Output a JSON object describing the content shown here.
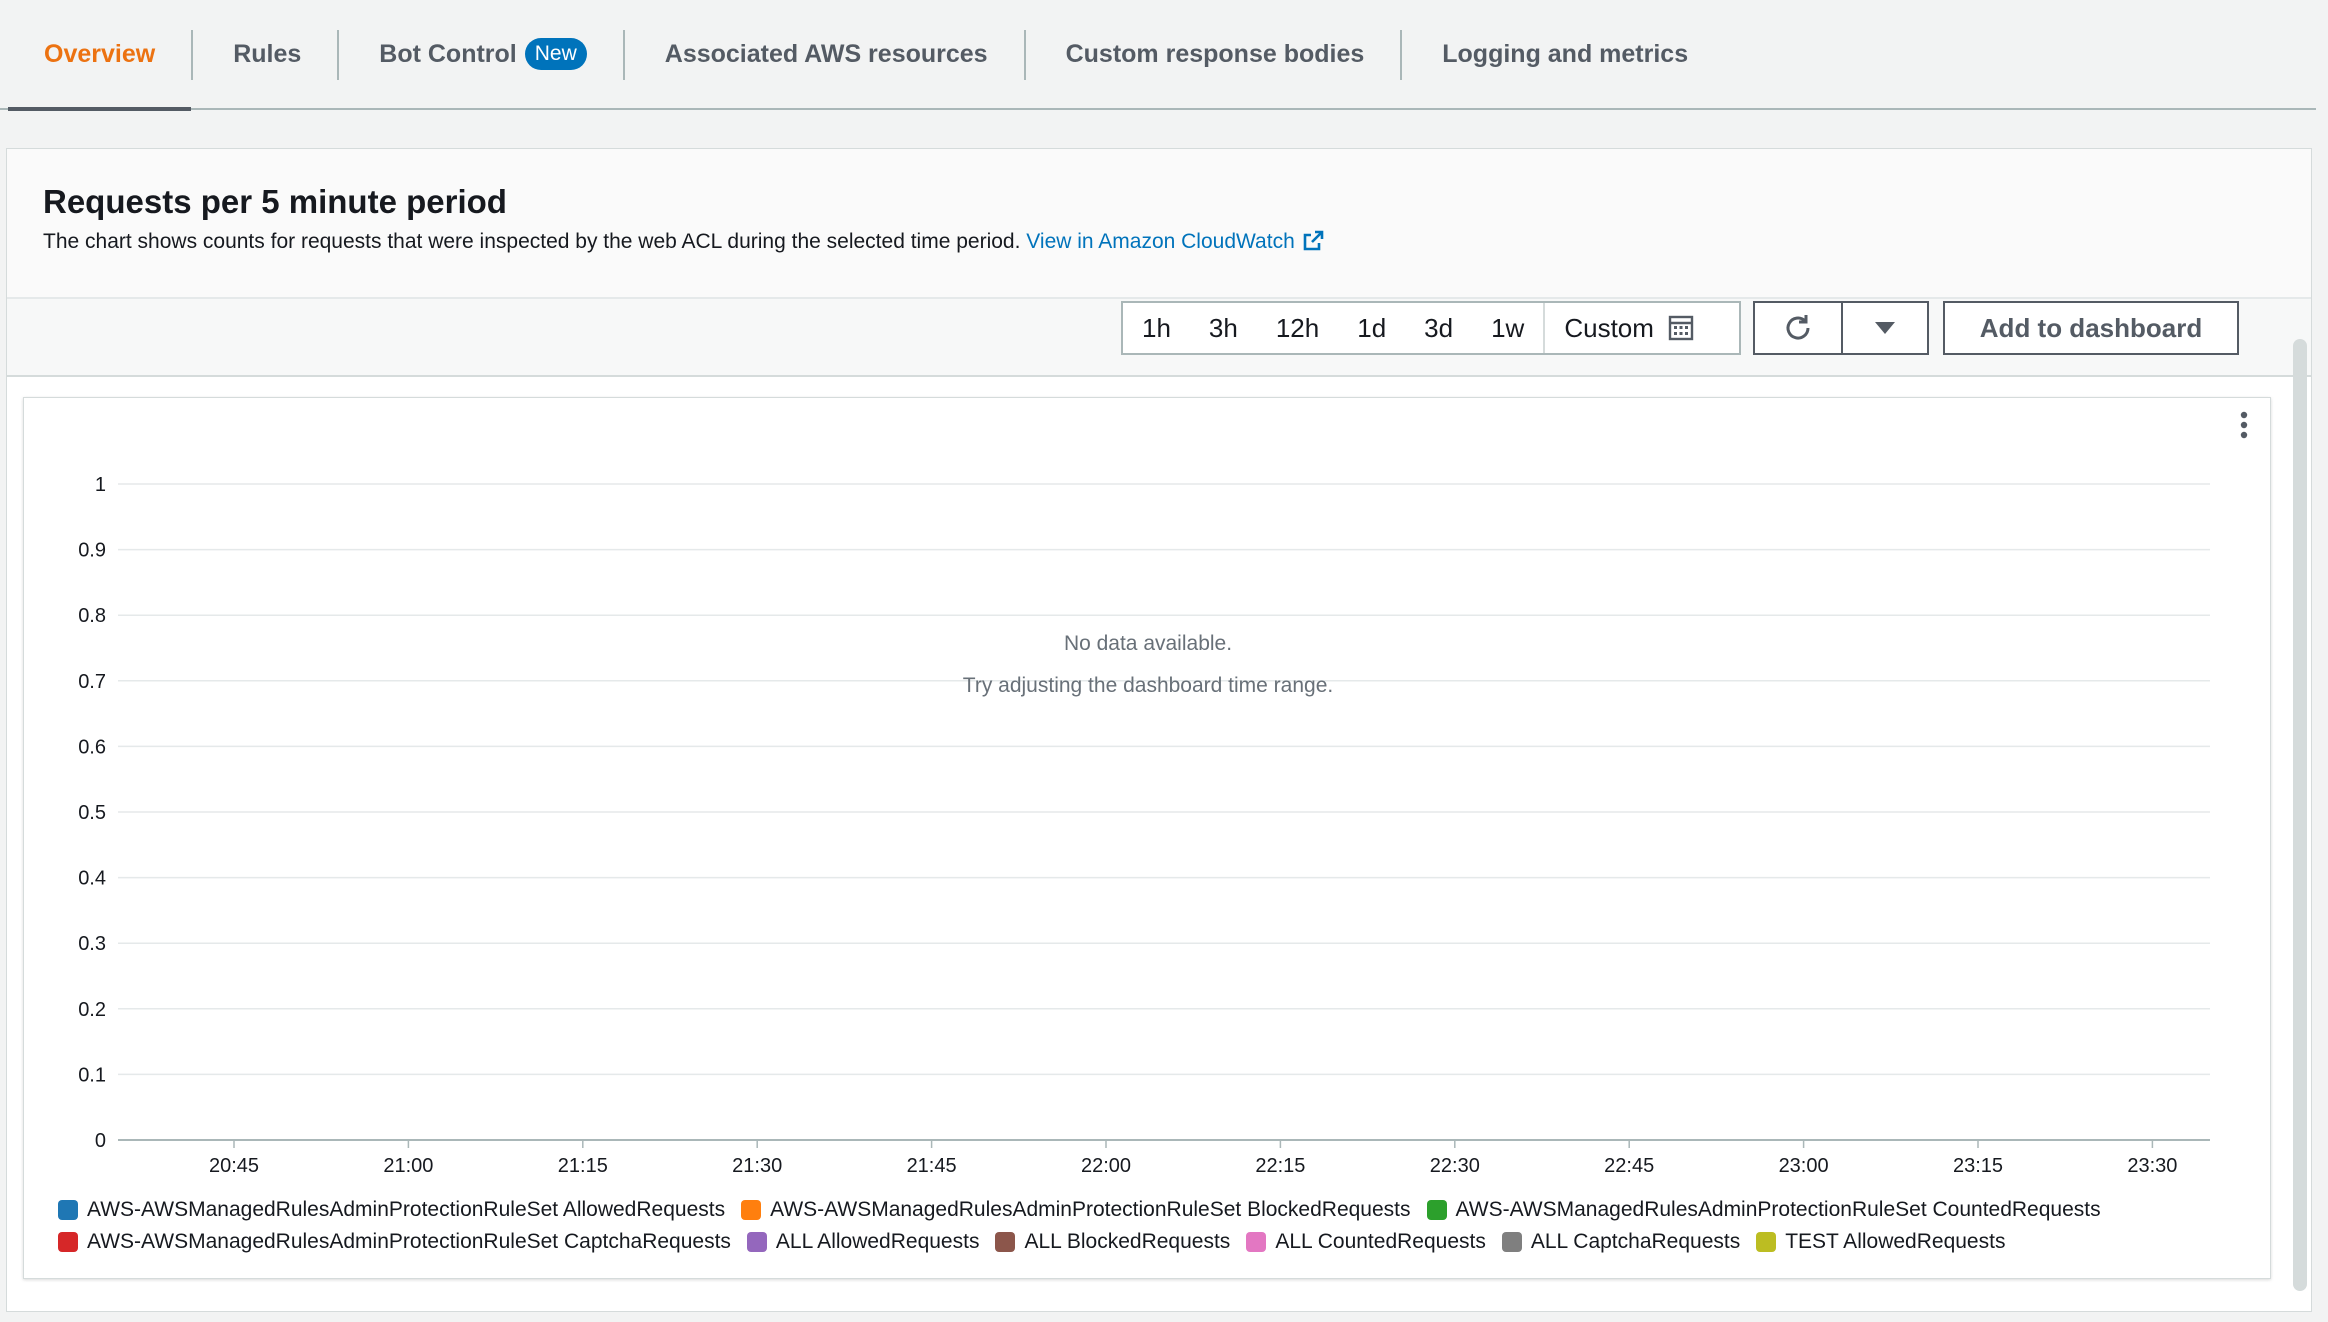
{
  "tabs": [
    {
      "label": "Overview",
      "active": true
    },
    {
      "label": "Rules"
    },
    {
      "label": "Bot Control",
      "badge": "New"
    },
    {
      "label": "Associated AWS resources"
    },
    {
      "label": "Custom response bodies"
    },
    {
      "label": "Logging and metrics"
    }
  ],
  "panel": {
    "title": "Requests per 5 minute period",
    "description": "The chart shows counts for requests that were inspected by the web ACL during the selected time period.",
    "link_text": "View in Amazon CloudWatch"
  },
  "toolbar": {
    "ranges": [
      "1h",
      "3h",
      "12h",
      "1d",
      "3d",
      "1w"
    ],
    "custom_label": "Custom",
    "add_label": "Add to dashboard",
    "refresh_icon": "refresh-icon",
    "dropdown_icon": "caret-down-icon"
  },
  "empty_state": {
    "line1": "No data available.",
    "line2": "Try adjusting the dashboard time range."
  },
  "chart_data": {
    "type": "line",
    "x_ticks": [
      "20:45",
      "21:00",
      "21:15",
      "21:30",
      "21:45",
      "22:00",
      "22:15",
      "22:30",
      "22:45",
      "23:00",
      "23:15",
      "23:30"
    ],
    "y_ticks": [
      "0",
      "0.1",
      "0.2",
      "0.3",
      "0.4",
      "0.5",
      "0.6",
      "0.7",
      "0.8",
      "0.9",
      "1"
    ],
    "ylim": [
      0,
      1
    ],
    "grid": true,
    "legend_position": "bottom",
    "series": [
      {
        "name": "AWS-AWSManagedRulesAdminProtectionRuleSet AllowedRequests",
        "color": "#1f77b4",
        "values": []
      },
      {
        "name": "AWS-AWSManagedRulesAdminProtectionRuleSet BlockedRequests",
        "color": "#ff7f0e",
        "values": []
      },
      {
        "name": "AWS-AWSManagedRulesAdminProtectionRuleSet CountedRequests",
        "color": "#2ca02c",
        "values": []
      },
      {
        "name": "AWS-AWSManagedRulesAdminProtectionRuleSet CaptchaRequests",
        "color": "#d62728",
        "values": []
      },
      {
        "name": "ALL AllowedRequests",
        "color": "#9467bd",
        "values": []
      },
      {
        "name": "ALL BlockedRequests",
        "color": "#8c564b",
        "values": []
      },
      {
        "name": "ALL CountedRequests",
        "color": "#e377c2",
        "values": []
      },
      {
        "name": "ALL CaptchaRequests",
        "color": "#7f7f7f",
        "values": []
      },
      {
        "name": "TEST AllowedRequests",
        "color": "#bcbd22",
        "values": []
      }
    ]
  }
}
